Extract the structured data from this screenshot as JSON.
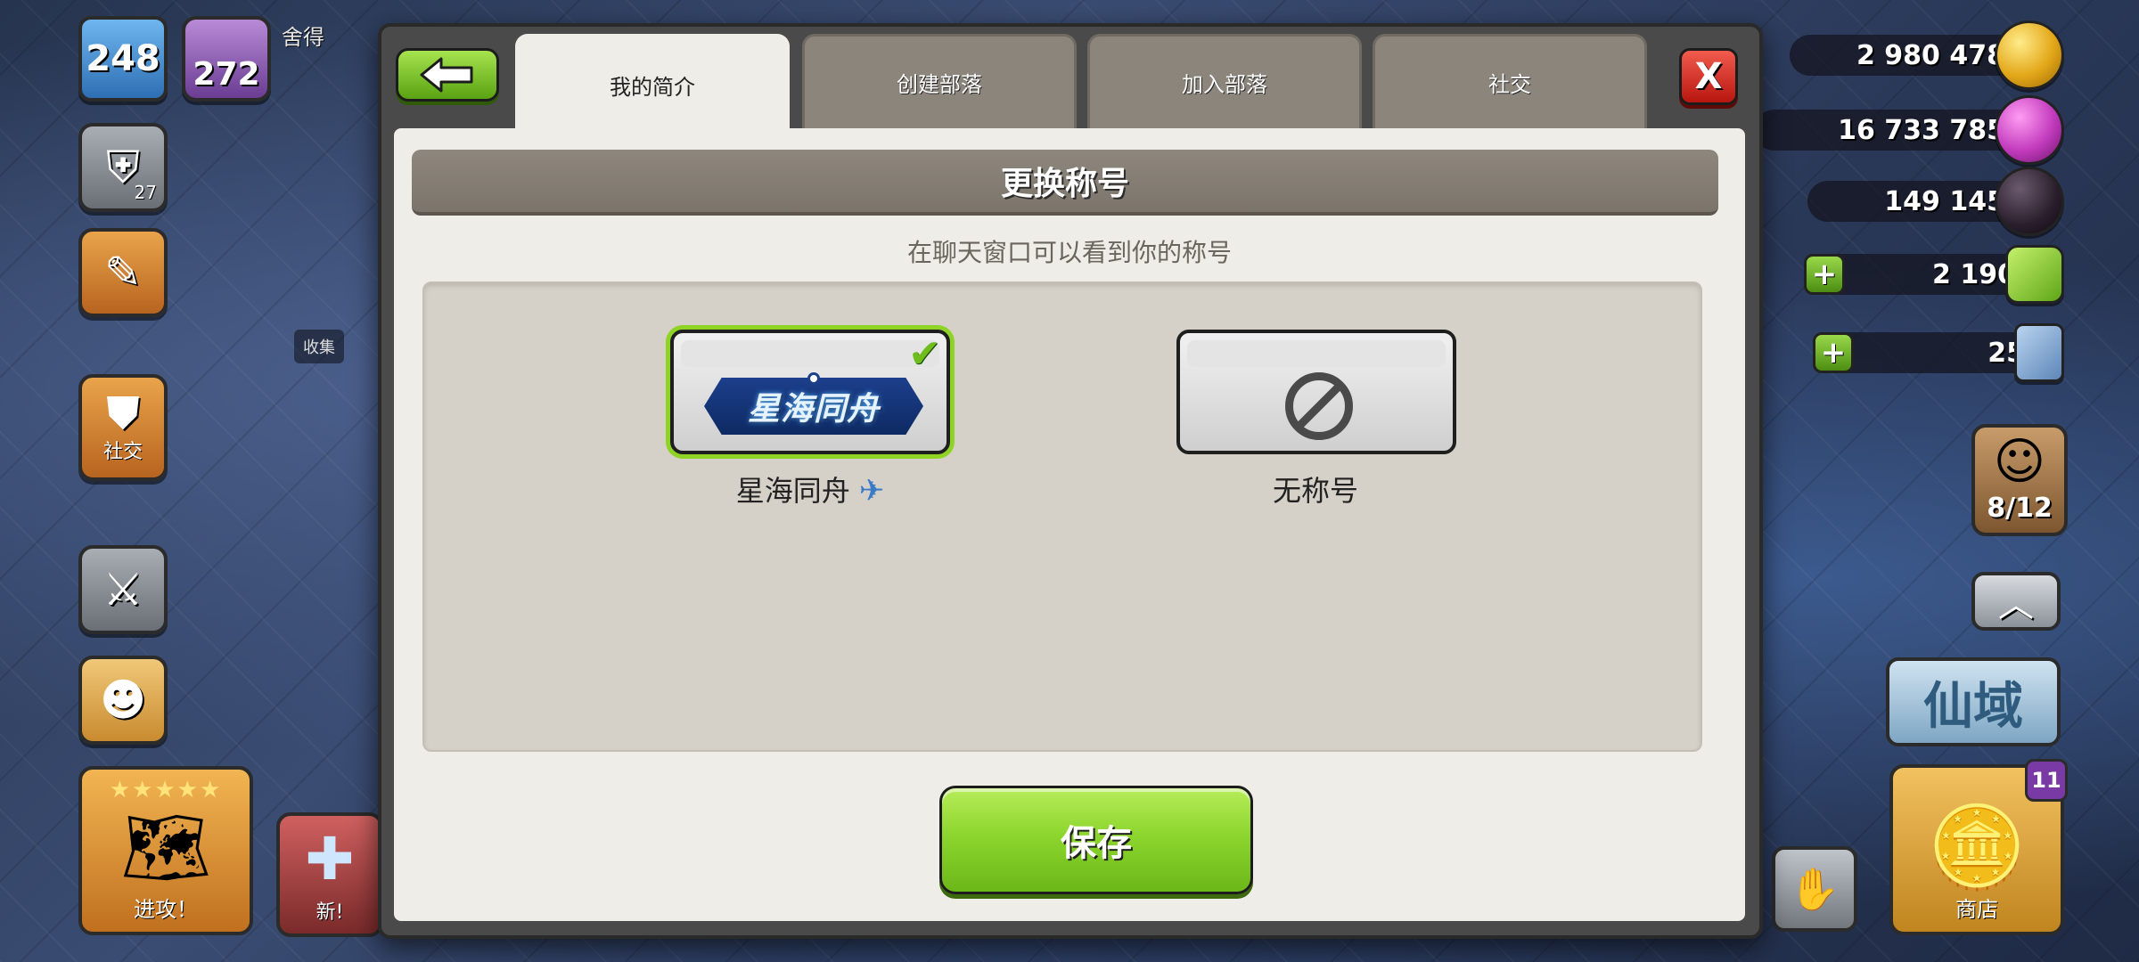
{
  "hud": {
    "level": "248",
    "trophies": "272",
    "player_name": "舍得",
    "troop_count": "27",
    "social_label": "社交",
    "collect_label": "收集",
    "attack_label": "进攻！",
    "attack_stars": "★★★★★",
    "new_label": "新!",
    "builder_count": "8/12",
    "event_label": "仙域",
    "shop_label": "商店",
    "shop_badge": "11"
  },
  "resources": {
    "gold": "2 980 478",
    "elixir": "16 733 785",
    "dark_elixir": "149 145",
    "gems": "2 190",
    "tickets": "25"
  },
  "modal": {
    "tabs": [
      {
        "label": "我的简介",
        "active": true
      },
      {
        "label": "创建部落",
        "active": false
      },
      {
        "label": "加入部落",
        "active": false
      },
      {
        "label": "社交",
        "active": false
      }
    ],
    "close_label": "X",
    "section_title": "更换称号",
    "subtitle": "在聊天窗口可以看到你的称号",
    "titles": [
      {
        "name": "星海同舟",
        "badge_text": "星海同舟",
        "selected": true
      },
      {
        "name": "无称号",
        "selected": false
      }
    ],
    "save_label": "保存"
  },
  "colors": {
    "accent_green": "#8dd62e",
    "close_red": "#d8261c",
    "panel_bg": "#efede7",
    "header_bg": "#857e74"
  }
}
